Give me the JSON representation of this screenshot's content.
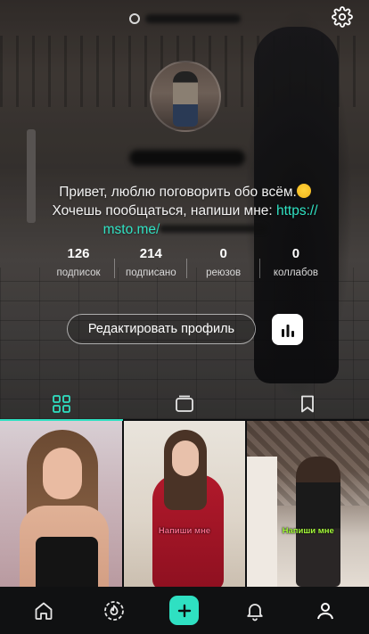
{
  "header": {
    "settings_icon": "gear-icon",
    "handle_icon": "at-sign-icon"
  },
  "profile": {
    "bio_line1": "Привет, люблю поговорить обо всём.",
    "bio_line2_text": "Хочешь пообщаться, напиши мне: ",
    "bio_link_start": "https://",
    "bio_link_rest": "msto.me/",
    "link_color": "#30e3c4"
  },
  "stats": [
    {
      "value": "126",
      "label": "подписок"
    },
    {
      "value": "214",
      "label": "подписано"
    },
    {
      "value": "0",
      "label": "реюзов"
    },
    {
      "value": "0",
      "label": "коллабов"
    }
  ],
  "actions": {
    "edit_profile": "Редактировать профиль",
    "stats_icon": "bar-chart-icon"
  },
  "tabs": [
    {
      "icon": "grid-icon",
      "active": true
    },
    {
      "icon": "repost-icon",
      "active": false
    },
    {
      "icon": "bookmark-icon",
      "active": false
    }
  ],
  "posts": [
    {
      "caption": ""
    },
    {
      "caption": "Напиши мне"
    },
    {
      "caption": "Напиши мне"
    }
  ],
  "bottom_nav": [
    {
      "icon": "home-icon"
    },
    {
      "icon": "explore-icon"
    },
    {
      "icon": "add-icon"
    },
    {
      "icon": "bell-icon"
    },
    {
      "icon": "profile-icon",
      "active": true
    }
  ],
  "colors": {
    "accent": "#2fe0c2",
    "background": "#0d0e10"
  }
}
